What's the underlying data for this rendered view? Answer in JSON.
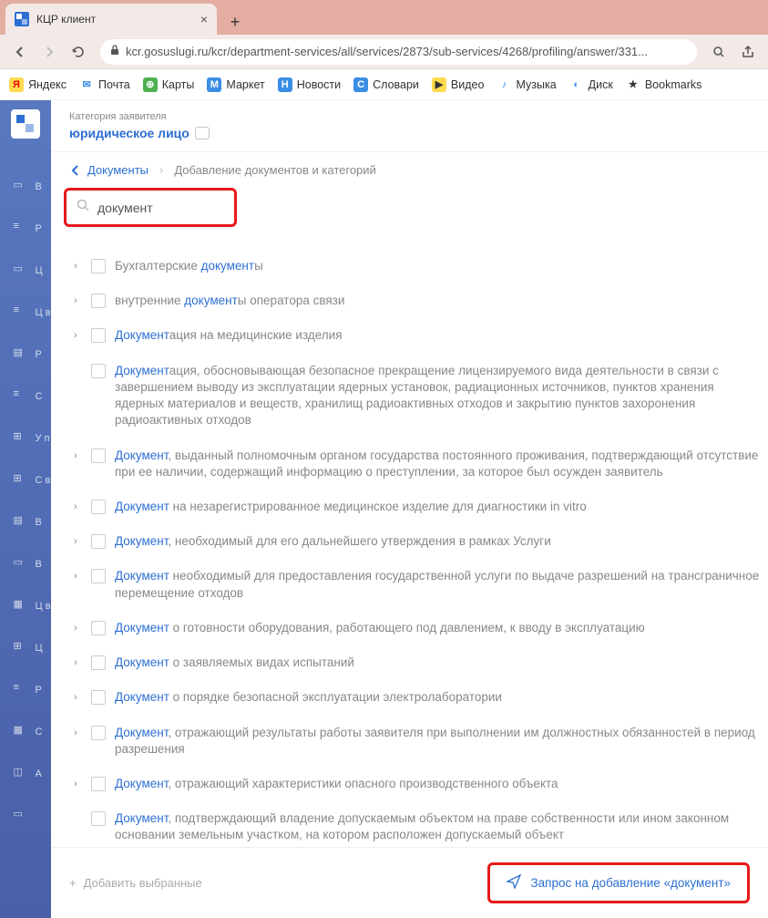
{
  "browser": {
    "tab_title": "КЦР клиент",
    "url": "kcr.gosuslugi.ru/kcr/department-services/all/services/2873/sub-services/4268/profiling/answer/331...",
    "bookmarks": [
      {
        "label": "Яндекс",
        "icon": "Я",
        "bg": "#ffdb4d",
        "color": "#f00"
      },
      {
        "label": "Почта",
        "icon": "✉",
        "bg": "#fff",
        "color": "#3b8ee5"
      },
      {
        "label": "Карты",
        "icon": "⊕",
        "bg": "#4caf50",
        "color": "#fff"
      },
      {
        "label": "Маркет",
        "icon": "М",
        "bg": "#3b8ee5",
        "color": "#fff"
      },
      {
        "label": "Новости",
        "icon": "Н",
        "bg": "#3b8ee5",
        "color": "#fff"
      },
      {
        "label": "Словари",
        "icon": "С",
        "bg": "#3b8ee5",
        "color": "#fff"
      },
      {
        "label": "Видео",
        "icon": "▶",
        "bg": "#ffdb4d",
        "color": "#333"
      },
      {
        "label": "Музыка",
        "icon": "♪",
        "bg": "#fff",
        "color": "#3b8ee5"
      },
      {
        "label": "Диск",
        "icon": "◐",
        "bg": "#fff",
        "color": "#3b8ee5"
      },
      {
        "label": "Bookmarks",
        "icon": "★",
        "bg": "#fff",
        "color": "#333"
      }
    ]
  },
  "sidebar": {
    "items": [
      {
        "label": "В"
      },
      {
        "label": "Р"
      },
      {
        "label": "Ц"
      },
      {
        "label": "Ц в"
      },
      {
        "label": "Р"
      },
      {
        "label": "С"
      },
      {
        "label": "У п"
      },
      {
        "label": "С в"
      },
      {
        "label": "В"
      },
      {
        "label": "В"
      },
      {
        "label": "Ц в"
      },
      {
        "label": "Ц"
      },
      {
        "label": "Р"
      },
      {
        "label": "С"
      },
      {
        "label": "А"
      },
      {
        "label": ""
      }
    ]
  },
  "header": {
    "category_label": "Категория заявителя",
    "category_value": "юридическое лицо"
  },
  "breadcrumb": {
    "back": "Документы",
    "current": "Добавление документов и категорий"
  },
  "search": {
    "value": "документ"
  },
  "items": [
    {
      "chev": true,
      "pre": "Бухгалтерские ",
      "hl": "документ",
      "post": "ы"
    },
    {
      "chev": true,
      "pre": "внутренние ",
      "hl": "документ",
      "post": "ы оператора связи"
    },
    {
      "chev": true,
      "pre": "",
      "hl": "Документ",
      "post": "ация на медицинские изделия"
    },
    {
      "chev": false,
      "pre": "",
      "hl": "Документ",
      "post": "ация, обосновывающая безопасное прекращение лицензируемого вида деятельности в связи с завершением выводу из эксплуатации ядерных установок, радиационных источников, пунктов хранения ядерных материалов и веществ, хранилищ радиоактивных отходов и закрытию пунктов захоронения радиоактивных отходов"
    },
    {
      "chev": true,
      "pre": "",
      "hl": "Документ",
      "post": ", выданный полномочным органом государства постоянного проживания, подтверждающий отсутствие при ее наличии, содержащий информацию о преступлении, за которое был осужден заявитель"
    },
    {
      "chev": true,
      "pre": "",
      "hl": "Документ",
      "post": " на незарегистрированное медицинское изделие для диагностики in vitro"
    },
    {
      "chev": true,
      "pre": "",
      "hl": "Документ",
      "post": ", необходимый для его дальнейшего утверждения в рамках Услуги"
    },
    {
      "chev": true,
      "pre": "",
      "hl": "Документ",
      "post": " необходимый для предоставления государственной услуги по выдаче разрешений на трансграничное перемещение отходов"
    },
    {
      "chev": true,
      "pre": "",
      "hl": "Документ",
      "post": " о готовности оборудования, работающего под давлением, к вводу в эксплуатацию"
    },
    {
      "chev": true,
      "pre": "",
      "hl": "Документ",
      "post": " о заявляемых видах испытаний"
    },
    {
      "chev": true,
      "pre": "",
      "hl": "Документ",
      "post": " о порядке безопасной эксплуатации электролаборатории"
    },
    {
      "chev": true,
      "pre": "",
      "hl": "Документ",
      "post": ", отражающий результаты работы заявителя при выполнении им должностных обязанностей в период разрешения"
    },
    {
      "chev": true,
      "pre": "",
      "hl": "Документ",
      "post": ", отражающий характеристики опасного производственного объекта"
    },
    {
      "chev": false,
      "pre": "",
      "hl": "Документ",
      "post": ", подтверждающий владение допускаемым объектом на праве собственности или ином законном основании земельным участком, на котором расположен допускаемый объект"
    }
  ],
  "footer": {
    "add_selected": "Добавить выбранные",
    "request": "Запрос на добавление «документ»"
  }
}
